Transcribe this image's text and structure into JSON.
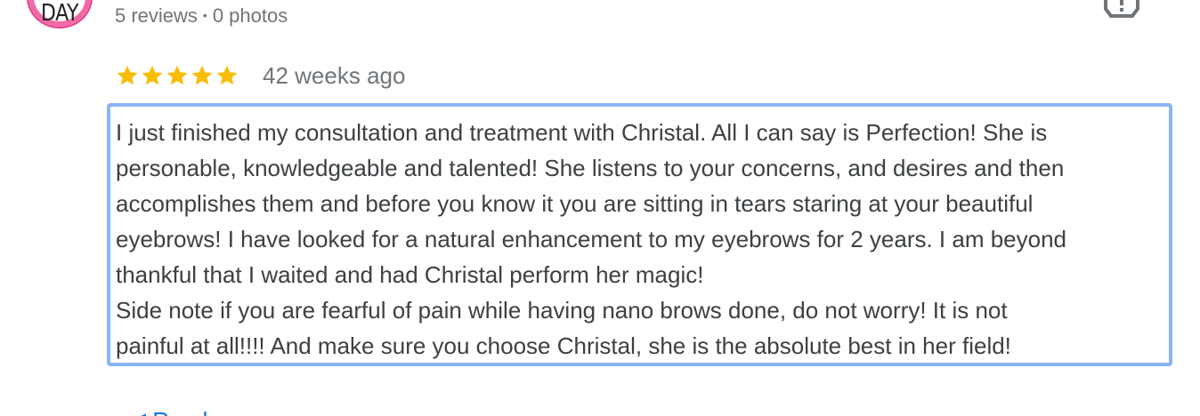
{
  "reviewer": {
    "avatar_text": "DAY",
    "reviews_count": "5 reviews",
    "separator": "•",
    "photos_count": "0 photos"
  },
  "review": {
    "rating": 5,
    "max_rating": 5,
    "time_ago": "42 weeks ago",
    "text_lines": [
      "I just finished my consultation and treatment with Christal. All I can say is Perfection! She is",
      "personable, knowledgeable and talented! She listens to your concerns, and desires and then",
      "accomplishes them and before you know it you are sitting in tears staring at your beautiful",
      "eyebrows! I have looked for a natural enhancement to my eyebrows for 2 years. I am beyond",
      "thankful that I waited and had Christal perform her magic!",
      "Side note if you are fearful of pain while having nano brows done, do not worry! It is not",
      "painful at all!!!! And make sure you choose Christal, she is the absolute best in her field!"
    ]
  },
  "icons": {
    "flag": "report-flag-icon",
    "star": "star-icon"
  },
  "colors": {
    "star": "#fbbc04",
    "focus_border": "#8ab4f8",
    "meta_text": "#70757a",
    "body_text": "#3c4043",
    "link": "#1a73e8"
  }
}
